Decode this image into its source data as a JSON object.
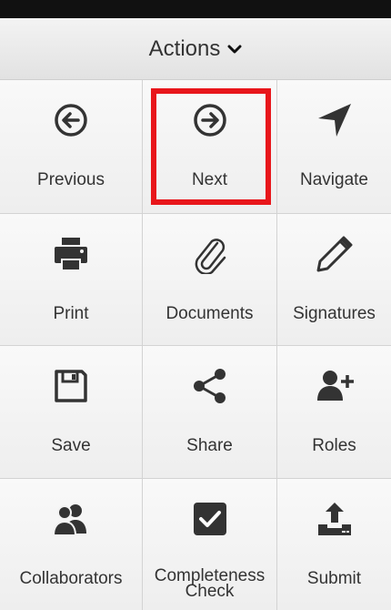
{
  "header": {
    "title": "Actions"
  },
  "actions": [
    {
      "label": "Previous",
      "icon": "arrow-left-circle-icon"
    },
    {
      "label": "Next",
      "icon": "arrow-right-circle-icon"
    },
    {
      "label": "Navigate",
      "icon": "navigate-arrow-icon"
    },
    {
      "label": "Print",
      "icon": "printer-icon"
    },
    {
      "label": "Documents",
      "icon": "paperclip-icon"
    },
    {
      "label": "Signatures",
      "icon": "pencil-icon"
    },
    {
      "label": "Save",
      "icon": "floppy-disk-icon"
    },
    {
      "label": "Share",
      "icon": "share-icon"
    },
    {
      "label": "Roles",
      "icon": "user-plus-icon"
    },
    {
      "label": "Collaborators",
      "icon": "users-icon"
    },
    {
      "label": "Completeness Check",
      "icon": "checkbox-checked-icon"
    },
    {
      "label": "Submit",
      "icon": "upload-tray-icon"
    }
  ],
  "colors": {
    "icon": "#333333",
    "highlight": "#e8161b"
  }
}
